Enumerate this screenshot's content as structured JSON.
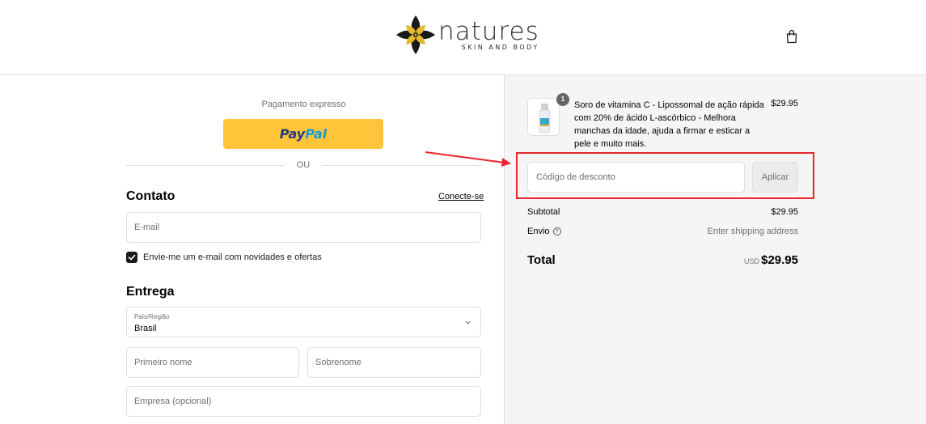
{
  "header": {
    "brand_name": "natures",
    "brand_tagline": "SKIN AND BODY",
    "cart_icon": "shopping-bag-icon"
  },
  "express": {
    "label": "Pagamento expresso",
    "paypal_part1": "Pay",
    "paypal_part2": "Pal",
    "paypal_color": "#ffc439",
    "divider_text": "OU"
  },
  "contact": {
    "title": "Contato",
    "login_link": "Conecte-se",
    "email_placeholder": "E-mail",
    "newsletter_label": "Envie-me um e-mail com novidades e ofertas",
    "newsletter_checked": true
  },
  "delivery": {
    "title": "Entrega",
    "country_label": "País/Região",
    "country_value": "Brasil",
    "first_name_placeholder": "Primeiro nome",
    "last_name_placeholder": "Sobrenome",
    "company_placeholder": "Empresa (opcional)"
  },
  "summary": {
    "product": {
      "quantity": "1",
      "name": "Soro de vitamina C - Lipossomal de ação rápida com 20% de ácido L-ascórbico - Melhora manchas da idade, ajuda a firmar e esticar a pele e muito mais.",
      "price": "$29.95"
    },
    "discount_placeholder": "Código de desconto",
    "apply_label": "Aplicar",
    "subtotal_label": "Subtotal",
    "subtotal_value": "$29.95",
    "shipping_label": "Envio",
    "shipping_value": "Enter shipping address",
    "total_label": "Total",
    "total_currency": "USD",
    "total_value": "$29.95",
    "highlight_color": "#e8262c"
  }
}
